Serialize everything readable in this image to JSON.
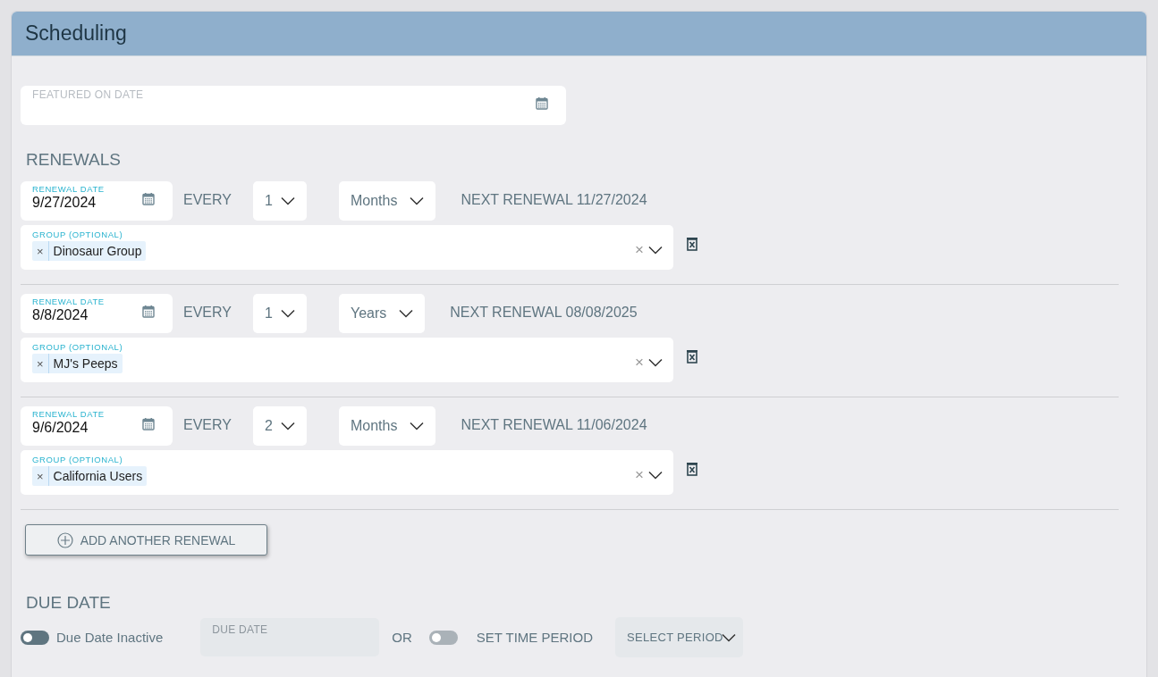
{
  "panel": {
    "title": "Scheduling"
  },
  "featured_on_date": {
    "label": "FEATURED ON DATE"
  },
  "renewals": {
    "heading": "RENEWALS",
    "items": [
      {
        "date_label": "RENEWAL DATE",
        "date": "9/27/2024",
        "every": "EVERY",
        "count": "1",
        "unit": "Months",
        "next": "NEXT RENEWAL 11/27/2024",
        "group_label": "GROUP (OPTIONAL)",
        "tags": [
          {
            "label": "Dinosaur Group",
            "remove": "×"
          }
        ],
        "clear": "×"
      },
      {
        "date_label": "RENEWAL DATE",
        "date": "8/8/2024",
        "every": "EVERY",
        "count": "1",
        "unit": "Years",
        "next": "NEXT RENEWAL 08/08/2025",
        "group_label": "GROUP (OPTIONAL)",
        "tags": [
          {
            "label": "MJ's Peeps",
            "remove": "×"
          }
        ],
        "clear": "×"
      },
      {
        "date_label": "RENEWAL DATE",
        "date": "9/6/2024",
        "every": "EVERY",
        "count": "2",
        "unit": "Months",
        "next": "NEXT RENEWAL 11/06/2024",
        "group_label": "GROUP (OPTIONAL)",
        "tags": [
          {
            "label": "California Users",
            "remove": "×"
          }
        ],
        "clear": "×"
      }
    ],
    "add_button": "ADD ANOTHER RENEWAL"
  },
  "due_date": {
    "heading": "DUE DATE",
    "toggle": {
      "label": "Due Date Inactive",
      "on": false,
      "disabled": false
    },
    "field": {
      "placeholder": "DUE DATE",
      "disabled": true
    },
    "or": "OR",
    "period_toggle": {
      "label": "SET TIME PERIOD",
      "on": false,
      "disabled": true
    },
    "period_select": {
      "placeholder": "SELECT PERIOD",
      "disabled": true
    }
  }
}
